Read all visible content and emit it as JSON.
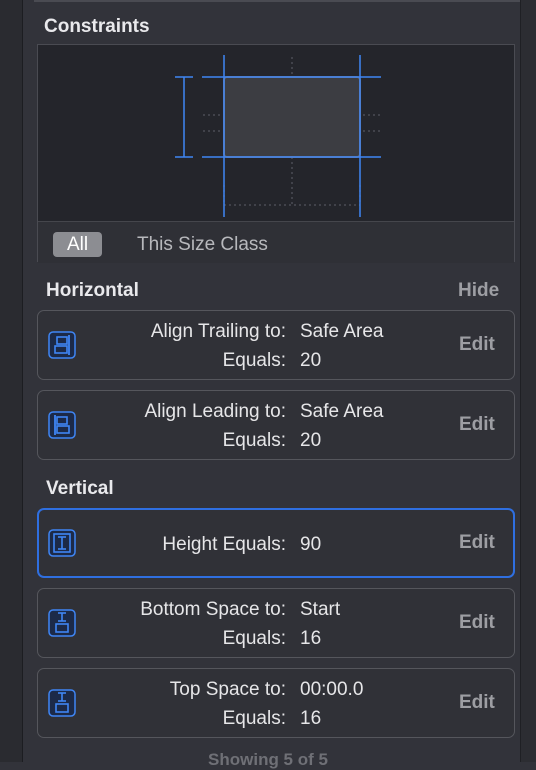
{
  "title": "Constraints",
  "size_class": {
    "all": "All",
    "this": "This Size Class"
  },
  "horizontal": {
    "title": "Horizontal",
    "hide": "Hide",
    "items": [
      {
        "line1_label": "Align Trailing to:",
        "line1_value": "Safe Area",
        "line2_label": "Equals:",
        "line2_value": "20",
        "edit": "Edit",
        "icon": "align-trailing-icon"
      },
      {
        "line1_label": "Align Leading to:",
        "line1_value": "Safe Area",
        "line2_label": "Equals:",
        "line2_value": "20",
        "edit": "Edit",
        "icon": "align-leading-icon"
      }
    ]
  },
  "vertical": {
    "title": "Vertical",
    "items": [
      {
        "line1_label": "Height Equals:",
        "line1_value": "90",
        "edit": "Edit",
        "icon": "height-icon"
      },
      {
        "line1_label": "Bottom Space to:",
        "line1_value": "Start",
        "line2_label": "Equals:",
        "line2_value": "16",
        "edit": "Edit",
        "icon": "bottom-space-icon"
      },
      {
        "line1_label": "Top Space to:",
        "line1_value": "00:00.0",
        "line2_label": "Equals:",
        "line2_value": "16",
        "edit": "Edit",
        "icon": "top-space-icon"
      }
    ]
  },
  "footer": "Showing 5 of 5",
  "colors": {
    "accent": "#2f6fe0",
    "panel": "#32333a",
    "preview": "#24252b"
  }
}
